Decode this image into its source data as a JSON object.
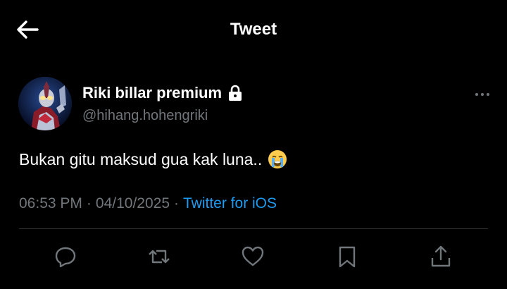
{
  "header": {
    "title": "Tweet",
    "back_icon": "arrow-left-icon"
  },
  "tweet": {
    "author": {
      "display_name": "Riki billar premium",
      "handle": "@hihang.hohengriki",
      "protected_icon": "lock-icon",
      "avatar": "ultraman-avatar"
    },
    "text": "Bukan gitu maksud gua kak luna..",
    "emoji": "loudly-crying-face",
    "time": "06:53 PM",
    "date": "04/10/2025",
    "separator": "·",
    "source": "Twitter for iOS"
  },
  "actions": [
    {
      "name": "reply",
      "icon": "reply-icon"
    },
    {
      "name": "retweet",
      "icon": "retweet-icon"
    },
    {
      "name": "like",
      "icon": "heart-icon"
    },
    {
      "name": "bookmark",
      "icon": "bookmark-icon"
    },
    {
      "name": "share",
      "icon": "share-icon"
    }
  ],
  "colors": {
    "background": "#000000",
    "text_primary": "#ffffff",
    "text_secondary": "#71767b",
    "link": "#1d9bf0",
    "divider": "#2f3336"
  }
}
